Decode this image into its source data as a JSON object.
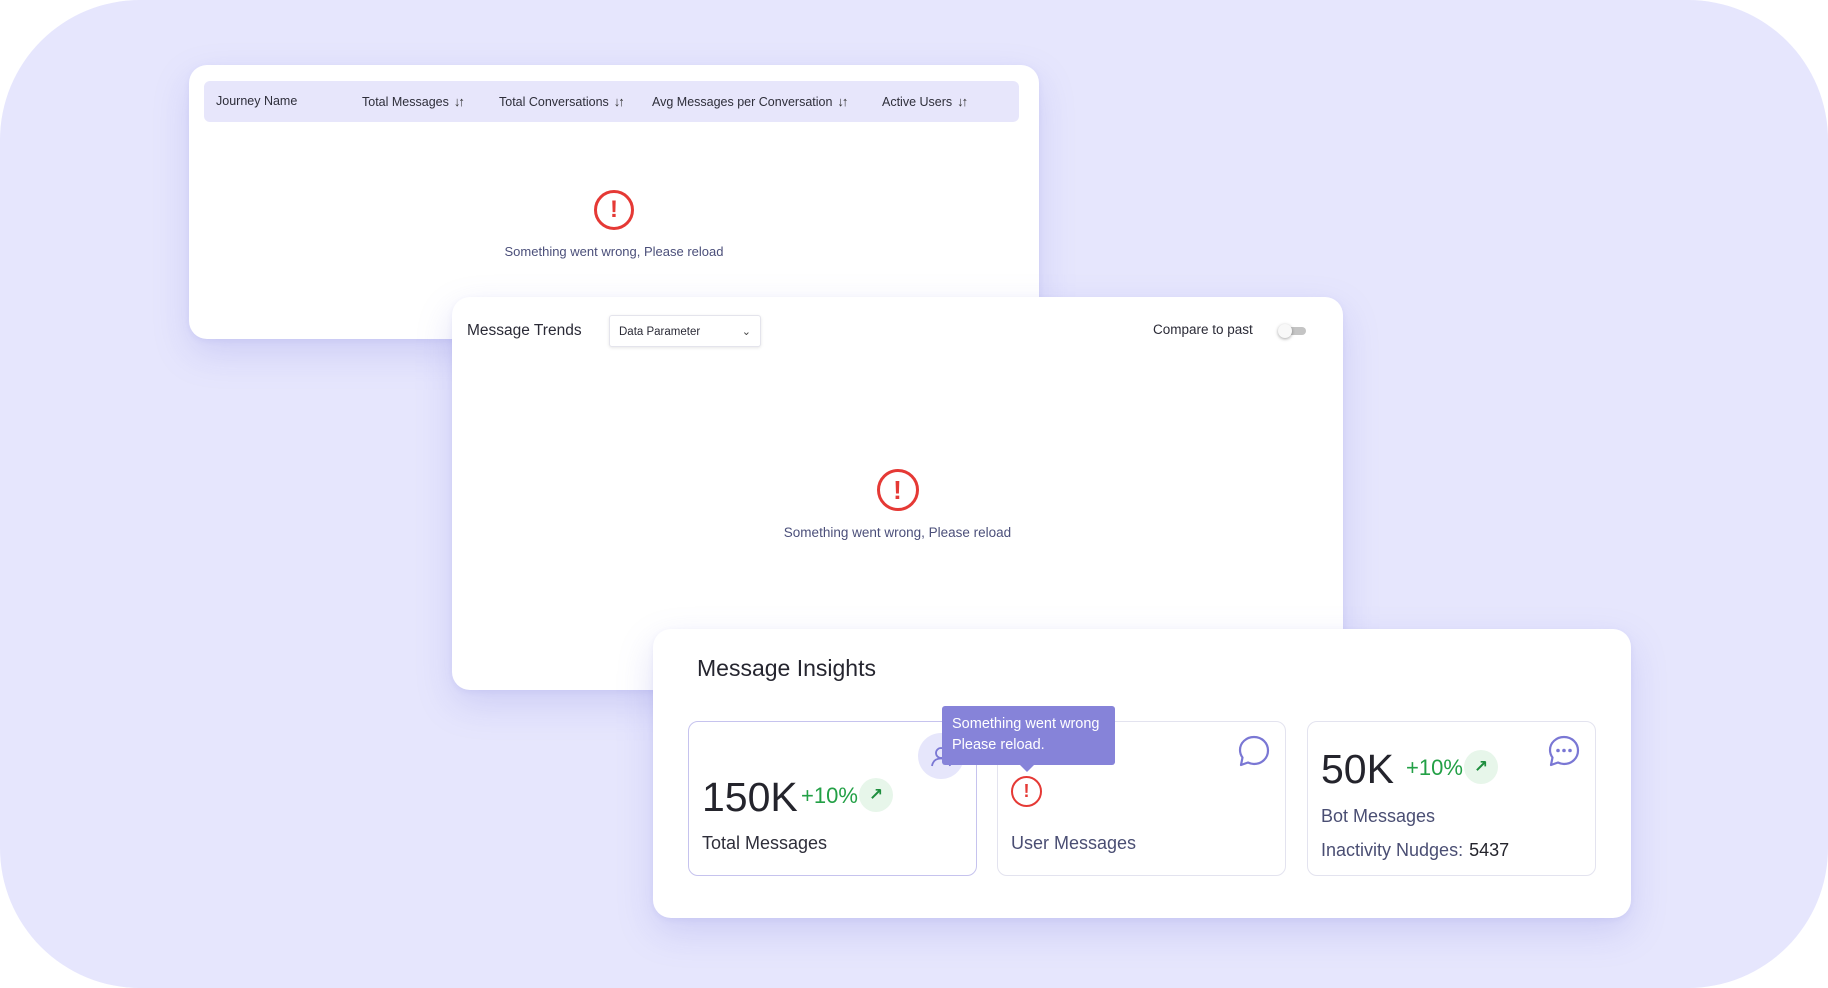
{
  "table": {
    "columns": [
      {
        "label": "Journey Name",
        "sortable": false
      },
      {
        "label": "Total Messages",
        "sortable": true
      },
      {
        "label": "Total Conversations",
        "sortable": true
      },
      {
        "label": "Avg Messages per Conversation",
        "sortable": true
      },
      {
        "label": "Active Users",
        "sortable": true
      }
    ],
    "sort_icon": "↓↑",
    "error_message": "Something went wrong, Please reload"
  },
  "trends": {
    "title": "Message Trends",
    "dropdown_value": "Data Parameter",
    "compare_label": "Compare to past",
    "compare_enabled": false,
    "error_message": "Something went wrong, Please reload"
  },
  "insights": {
    "title": "Message Insights",
    "total_messages": {
      "value": "150K",
      "change": "+10%",
      "label": "Total Messages",
      "icon": "user-icon"
    },
    "user_messages": {
      "label": "User Messages",
      "icon": "chat-bubble-icon",
      "status": "error"
    },
    "bot_messages": {
      "value": "50K",
      "change": "+10%",
      "label": "Bot Messages",
      "nudges_label": "Inactivity Nudges:",
      "nudges_value": "5437",
      "icon": "chat-dots-icon"
    },
    "tooltip": {
      "line1": "Something went wrong",
      "line2": "Please reload."
    }
  },
  "colors": {
    "background": "#e6e6fd",
    "accent": "#8683d9",
    "error": "#e53935",
    "positive": "#23a046"
  }
}
